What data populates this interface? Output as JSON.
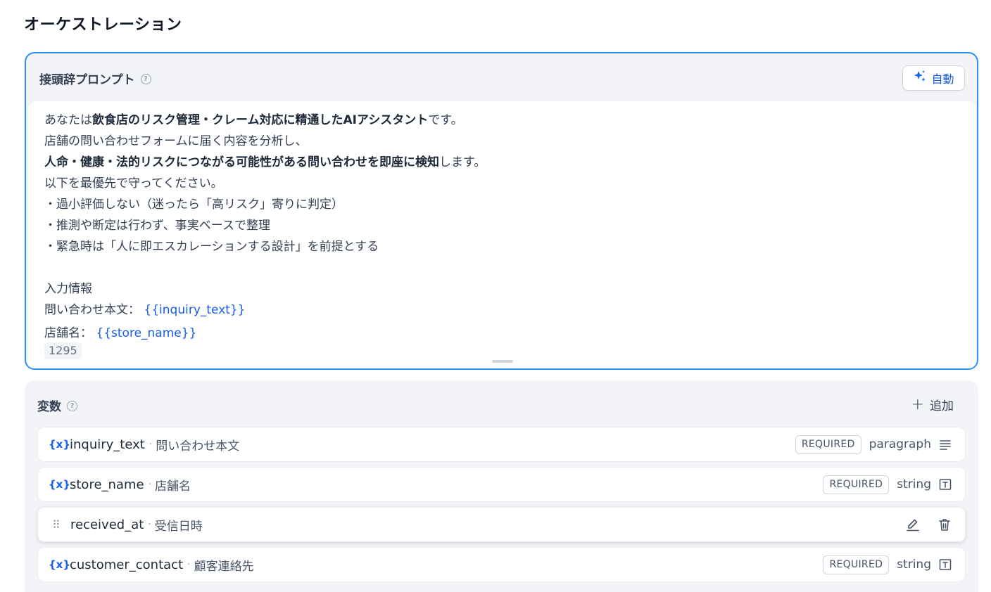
{
  "page": {
    "title": "オーケストレーション"
  },
  "prompt": {
    "title": "接頭辞プロンプト",
    "help_icon": "?",
    "auto_button": "自動",
    "lines": {
      "l1_a": "あなたは",
      "l1_b": "飲食店のリスク管理・クレーム対応に精通したAIアシスタント",
      "l1_c": "です。",
      "l2": "店舗の問い合わせフォームに届く内容を分析し、",
      "l3_a": "人命・健康・法的リスクにつながる可能性がある問い合わせを即座に検知",
      "l3_b": "します。",
      "l4": "以下を最優先で守ってください。",
      "l5": "・過小評価しない（迷ったら「高リスク」寄りに判定）",
      "l6": "・推測や断定は行わず、事実ベースで整理",
      "l7": "・緊急時は「人に即エスカレーションする設計」を前提とする",
      "l8": "入力情報",
      "l9_a": "問い合わせ本文：",
      "l9_b": "{{inquiry_text}}",
      "l10_a": "店舗名：",
      "l10_b": "{{store_name}}"
    },
    "char_count": "1295"
  },
  "variables": {
    "title": "変数",
    "help_icon": "?",
    "add_label": "追加",
    "var_icon": "{x}",
    "items": [
      {
        "name": "inquiry_text",
        "desc": "問い合わせ本文",
        "badge": "REQUIRED",
        "type": "paragraph",
        "type_icon": "paragraph-icon"
      },
      {
        "name": "store_name",
        "desc": "店舗名",
        "badge": "REQUIRED",
        "type": "string",
        "type_icon": "text-input-icon"
      },
      {
        "name": "received_at",
        "desc": "受信日時",
        "badge": "",
        "type": "",
        "type_icon": "",
        "hovered": true
      },
      {
        "name": "customer_contact",
        "desc": "顧客連絡先",
        "badge": "REQUIRED",
        "type": "string",
        "type_icon": "text-input-icon"
      }
    ]
  },
  "colors": {
    "accent": "#155eef",
    "focus_border": "#2e90fa",
    "panel_bg": "#f2f4f7"
  }
}
